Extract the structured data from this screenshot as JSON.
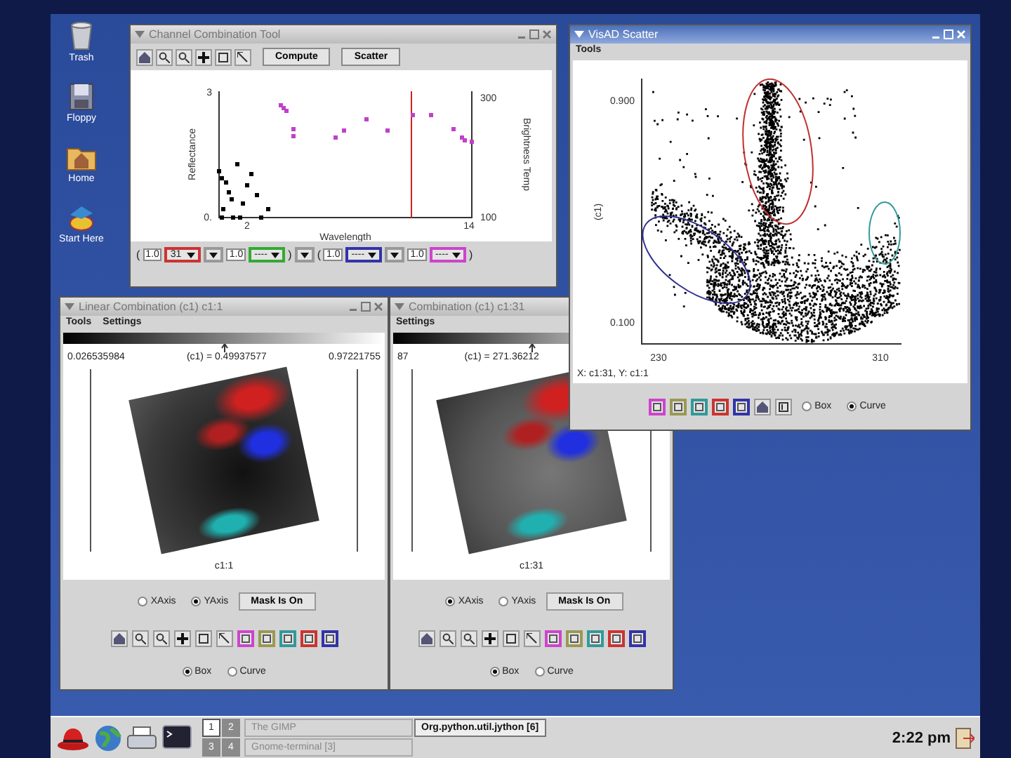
{
  "desktop_icons": [
    {
      "label": "Trash"
    },
    {
      "label": "Floppy"
    },
    {
      "label": "Home"
    },
    {
      "label": "Start Here"
    }
  ],
  "channel_tool": {
    "window": {
      "title": "Channel Combination Tool",
      "active": false
    },
    "buttons": [
      "Compute",
      "Scatter"
    ],
    "plot": {
      "y_left_label": "Reflectance",
      "y_right_label": "Brightness Temp",
      "x_label": "Wavelength",
      "x_ticks": [
        "2",
        "14"
      ],
      "y_left_ticks": [
        "3",
        "0."
      ],
      "y_right_ticks": [
        "300",
        "100"
      ]
    },
    "combination": [
      {
        "kind": "paren",
        "text": "("
      },
      {
        "kind": "number",
        "value": "1.0"
      },
      {
        "kind": "select",
        "value": "31",
        "color": "#cc3333"
      },
      {
        "kind": "select"
      },
      {
        "kind": "number",
        "value": "1.0"
      },
      {
        "kind": "select",
        "value": "----",
        "color": "#33aa33"
      },
      {
        "kind": "paren",
        "text": ")"
      },
      {
        "kind": "select"
      },
      {
        "kind": "paren",
        "text": "("
      },
      {
        "kind": "number",
        "value": "1.0"
      },
      {
        "kind": "select",
        "value": "----",
        "color": "#3333aa"
      },
      {
        "kind": "select"
      },
      {
        "kind": "number",
        "value": "1.0"
      },
      {
        "kind": "select",
        "value": "----",
        "color": "#cc44cc"
      },
      {
        "kind": "paren",
        "text": ")"
      }
    ]
  },
  "scatter": {
    "window": {
      "title": "VisAD Scatter",
      "active": true
    },
    "menu": [
      "Tools"
    ],
    "plot": {
      "y_label": "(c1)",
      "y_ticks": [
        "0.900",
        "0.100"
      ],
      "x_ticks": [
        "230",
        "310"
      ]
    },
    "status": "X: c1:31, Y: c1:1",
    "color_buttons": [
      {
        "color": "#cc44cc"
      },
      {
        "color": "#999955"
      },
      {
        "color": "#339999"
      },
      {
        "color": "#cc3333"
      },
      {
        "color": "#3333aa"
      }
    ],
    "modes": [
      {
        "label": "Box",
        "selected": false
      },
      {
        "label": "Curve",
        "selected": true
      }
    ]
  },
  "combinations": [
    {
      "window": {
        "title": "Linear Combination (c1) c1:1",
        "active": false
      },
      "menu": [
        "Tools",
        "Settings"
      ],
      "readings": [
        "0.026535984",
        "(c1) = 0.49937577",
        "0.97221755"
      ],
      "caption": "c1:1",
      "axes": [
        {
          "label": "XAxis",
          "selected": false
        },
        {
          "label": "YAxis",
          "selected": true
        }
      ],
      "mask_button": "Mask Is On",
      "color_buttons": [
        {
          "color": "#cc44cc"
        },
        {
          "color": "#999955"
        },
        {
          "color": "#339999"
        },
        {
          "color": "#cc3333"
        },
        {
          "color": "#3333aa"
        }
      ],
      "modes": [
        {
          "label": "Box",
          "selected": true
        },
        {
          "label": "Curve",
          "selected": false
        }
      ]
    },
    {
      "window": {
        "title": "Combination (c1) c1:31",
        "active": false
      },
      "menu": [
        "Settings"
      ],
      "readings": [
        "87",
        "(c1) = 271.36212"
      ],
      "caption": "c1:31",
      "axes": [
        {
          "label": "XAxis",
          "selected": true
        },
        {
          "label": "YAxis",
          "selected": false
        }
      ],
      "mask_button": "Mask Is On",
      "color_buttons": [
        {
          "color": "#cc44cc"
        },
        {
          "color": "#999955"
        },
        {
          "color": "#339999"
        },
        {
          "color": "#cc3333"
        },
        {
          "color": "#3333aa"
        }
      ],
      "modes": [
        {
          "label": "Box",
          "selected": true
        },
        {
          "label": "Curve",
          "selected": false
        }
      ]
    }
  ],
  "taskbar": {
    "pager": [
      {
        "label": "1",
        "selected": true
      },
      {
        "label": "2",
        "selected": false
      },
      {
        "label": "3",
        "selected": false
      },
      {
        "label": "4",
        "selected": false
      }
    ],
    "tasks": [
      {
        "label": "The GIMP",
        "selected": false
      },
      {
        "label": "Gnome-terminal [3]",
        "selected": false
      },
      {
        "label": "Org.python.util.jython [6]",
        "selected": true
      }
    ],
    "clock": "2:22 pm"
  }
}
